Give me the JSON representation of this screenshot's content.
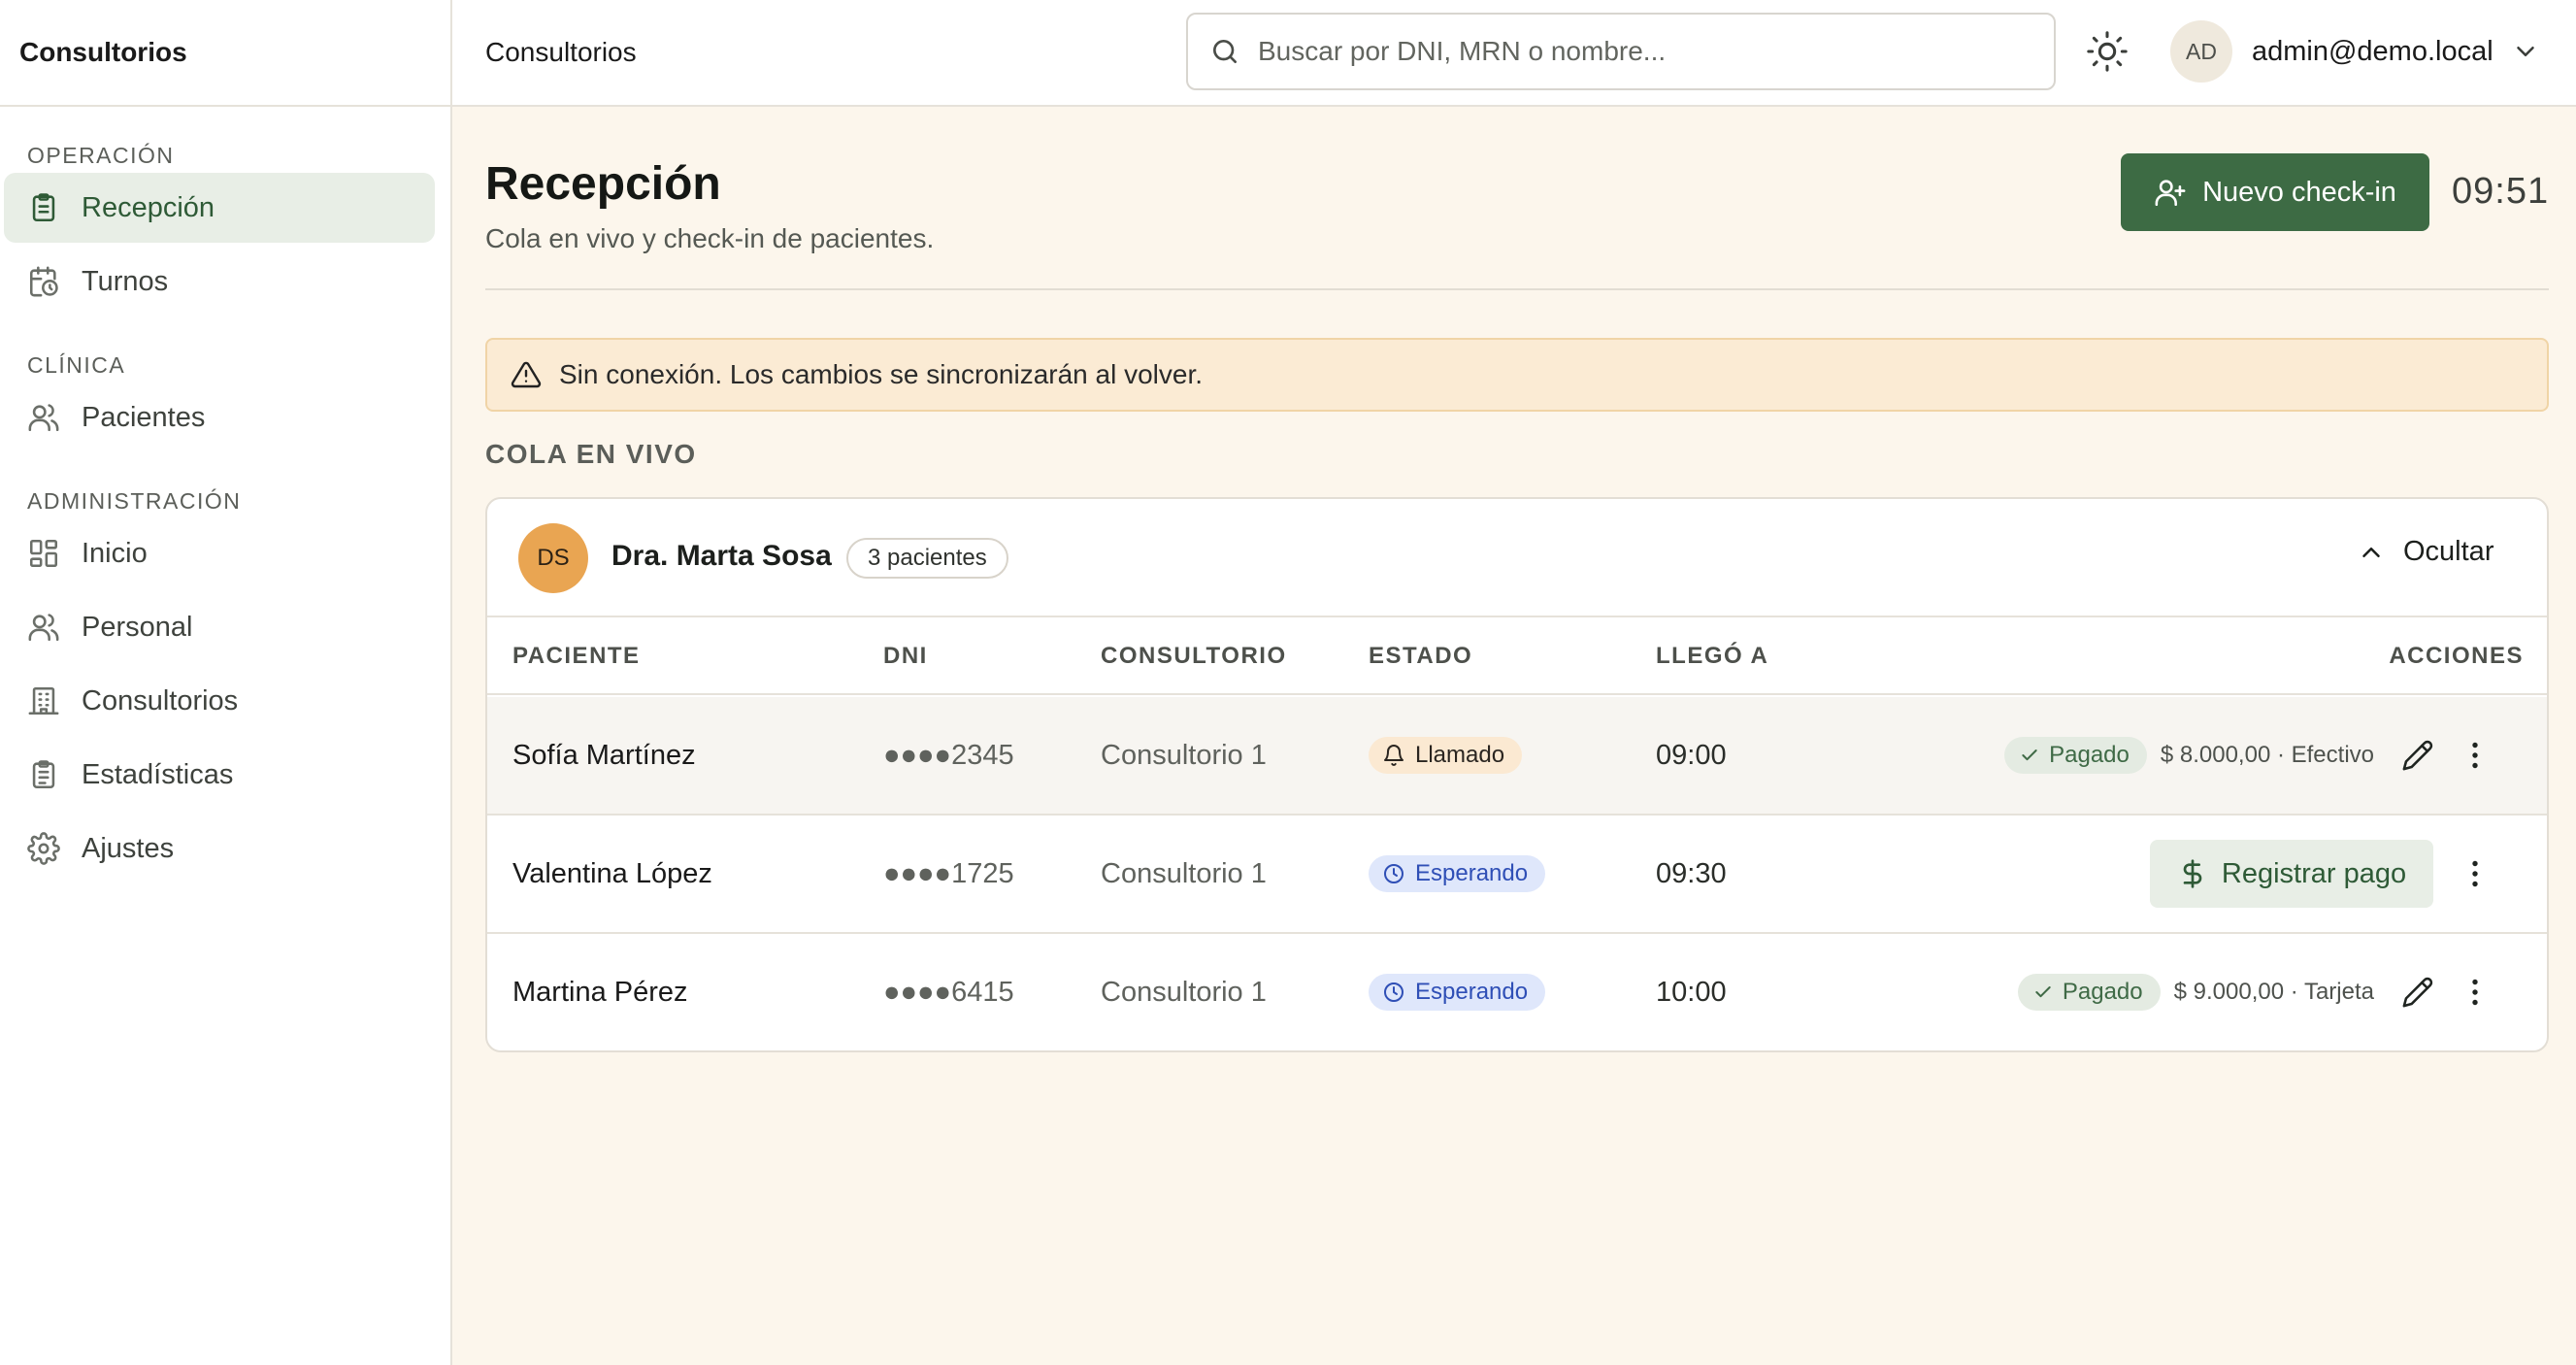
{
  "app": {
    "brand": "Consultorios"
  },
  "sidebar": {
    "sections": [
      {
        "title": "OPERACIÓN",
        "items": [
          {
            "label": "Recepción",
            "icon": "clipboard-icon",
            "active": true
          },
          {
            "label": "Turnos",
            "icon": "calendar-clock-icon"
          }
        ]
      },
      {
        "title": "CLÍNICA",
        "items": [
          {
            "label": "Pacientes",
            "icon": "users-icon"
          }
        ]
      },
      {
        "title": "ADMINISTRACIÓN",
        "items": [
          {
            "label": "Inicio",
            "icon": "dashboard-icon"
          },
          {
            "label": "Personal",
            "icon": "users-icon"
          },
          {
            "label": "Consultorios",
            "icon": "building-icon"
          },
          {
            "label": "Estadísticas",
            "icon": "clipboard-list-icon"
          },
          {
            "label": "Ajustes",
            "icon": "gear-icon"
          }
        ]
      }
    ]
  },
  "topbar": {
    "title": "Consultorios",
    "search_placeholder": "Buscar por DNI, MRN o nombre...",
    "user_initials": "AD",
    "user_email": "admin@demo.local"
  },
  "page": {
    "title": "Recepción",
    "subtitle": "Cola en vivo y check-in de pacientes.",
    "checkin_label": "Nuevo check-in",
    "clock": "09:51",
    "alert": "Sin conexión. Los cambios se sincronizarán al volver.",
    "section_label": "COLA EN VIVO"
  },
  "queue": {
    "doctor_initials": "DS",
    "doctor_name": "Dra. Marta Sosa",
    "count_label": "3 pacientes",
    "toggle_label": "Ocultar",
    "columns": [
      "PACIENTE",
      "DNI",
      "CONSULTORIO",
      "ESTADO",
      "LLEGÓ A",
      "ACCIONES"
    ],
    "rows": [
      {
        "name": "Sofía Martínez",
        "dni": "●●●●2345",
        "room": "Consultorio 1",
        "status": "Llamado",
        "arrived": "09:00",
        "paid_label": "Pagado",
        "payment": "$ 8.000,00 · Efectivo"
      },
      {
        "name": "Valentina López",
        "dni": "●●●●1725",
        "room": "Consultorio 1",
        "status": "Esperando",
        "arrived": "09:30",
        "action_label": "Registrar pago"
      },
      {
        "name": "Martina Pérez",
        "dni": "●●●●6415",
        "room": "Consultorio 1",
        "status": "Esperando",
        "arrived": "10:00",
        "paid_label": "Pagado",
        "payment": "$ 9.000,00 · Tarjeta"
      }
    ]
  },
  "colors": {
    "primary": "#3d6b44",
    "background": "#fcf6ec",
    "alert_bg": "#fbebd4",
    "doctor_avatar": "#e9a552",
    "status_waiting": "#2f4fb6",
    "status_called_bg": "#fbe9d2"
  }
}
